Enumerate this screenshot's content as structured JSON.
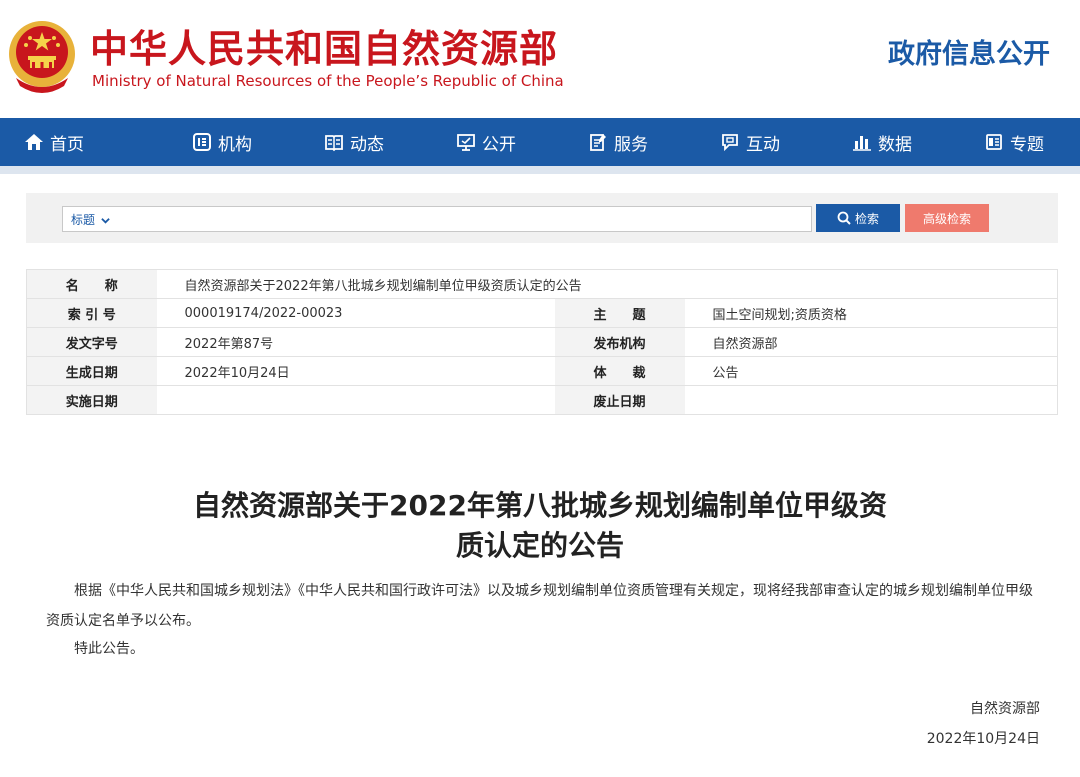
{
  "header": {
    "site_title": "中华人民共和国自然资源部",
    "site_subtitle": "Ministry of Natural Resources of the People’s Republic of China",
    "gov_info": "政府信息公开"
  },
  "nav": {
    "items": [
      {
        "label": "首页",
        "icon": "home-icon"
      },
      {
        "label": "机构",
        "icon": "organization-icon"
      },
      {
        "label": "动态",
        "icon": "news-icon"
      },
      {
        "label": "公开",
        "icon": "disclosure-icon"
      },
      {
        "label": "服务",
        "icon": "service-icon"
      },
      {
        "label": "互动",
        "icon": "chat-icon"
      },
      {
        "label": "数据",
        "icon": "chart-icon"
      },
      {
        "label": "专题",
        "icon": "topic-icon"
      }
    ]
  },
  "search": {
    "type_label": "标题",
    "query": "",
    "search_label": "检索",
    "advanced_label": "高级检索"
  },
  "info": {
    "name_label": "名　　称",
    "name_value": "自然资源部关于2022年第八批城乡规划编制单位甲级资质认定的公告",
    "index_label": "索 引 号",
    "index_value": "000019174/2022-00023",
    "subject_label": "主　　题",
    "subject_value": "国土空间规划;资质资格",
    "doc_no_label": "发文字号",
    "doc_no_value": "2022年第87号",
    "issuer_label": "发布机构",
    "issuer_value": "自然资源部",
    "created_label": "生成日期",
    "created_value": "2022年10月24日",
    "genre_label": "体　　裁",
    "genre_value": "公告",
    "effective_label": "实施日期",
    "effective_value": "",
    "abolish_label": "废止日期",
    "abolish_value": ""
  },
  "article": {
    "title_line1": "自然资源部关于2022年第八批城乡规划编制单位甲级资",
    "title_line2": "质认定的公告",
    "paragraph1": "根据《中华人民共和国城乡规划法》《中华人民共和国行政许可法》以及城乡规划编制单位资质管理有关规定，现将经我部审查认定的城乡规划编制单位甲级资质认定名单予以公布。",
    "paragraph2": "特此公告。",
    "signature": "自然资源部",
    "date": "2022年10月24日"
  },
  "colors": {
    "brand_red": "#c8161d",
    "nav_blue": "#1b5aa6",
    "advanced_button": "#ef7a6d"
  }
}
